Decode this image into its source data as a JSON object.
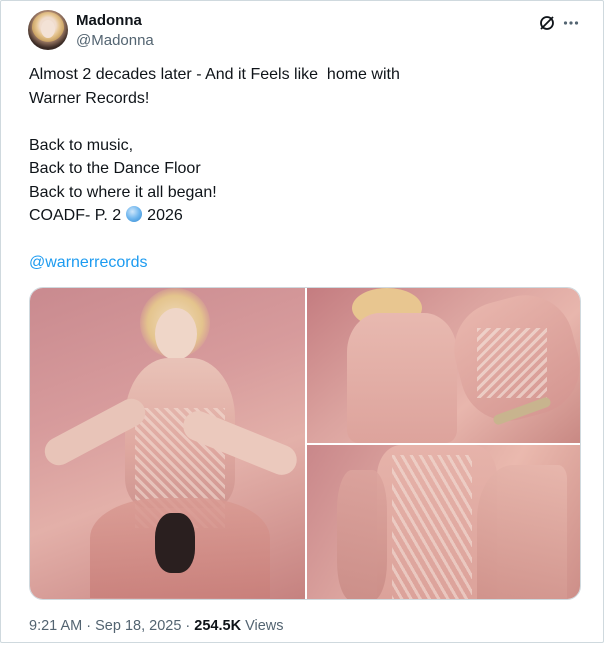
{
  "author": {
    "display_name": "Madonna",
    "handle": "@Madonna"
  },
  "header_icons": {
    "grok": "grok-icon",
    "more": "more-icon"
  },
  "tweet": {
    "line_1": "Almost 2 decades later - And it Feels like  home with",
    "line_2": "Warner Records!",
    "line_3": "Back to music,",
    "line_4": "Back to the Dance Floor",
    "line_5": "Back to where it all began!",
    "line_6_before": "COADF- P. 2",
    "line_6_emoji": "globe-emoji",
    "line_6_after": "2026",
    "mention": "@warnerrecords"
  },
  "media": {
    "photo_count": 3
  },
  "meta": {
    "time": "9:21 AM",
    "separator": "·",
    "date": "Sep 18, 2025",
    "views_count": "254.5K",
    "views_label": "Views"
  },
  "colors": {
    "link": "#1d9bf0",
    "secondary_text": "#536471",
    "primary_text": "#0f1419",
    "border": "#cfd9de"
  }
}
